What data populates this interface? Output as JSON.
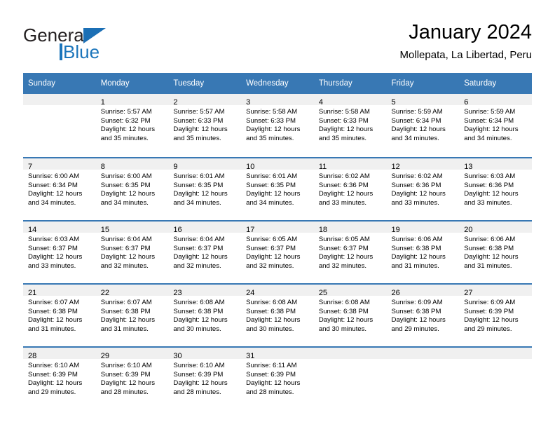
{
  "brand": {
    "name_part1": "General",
    "name_part2": "Blue",
    "logo_icon": "triangle-logo-icon"
  },
  "header": {
    "title": "January 2024",
    "subtitle": "Mollepata, La Libertad, Peru"
  },
  "calendar": {
    "weekday_headers": [
      "Sunday",
      "Monday",
      "Tuesday",
      "Wednesday",
      "Thursday",
      "Friday",
      "Saturday"
    ],
    "accent_color": "#3878b4",
    "daynum_band_color": "#f0f0f0",
    "weeks": [
      [
        {
          "day": "",
          "sunrise": "",
          "sunset": "",
          "daylight_line1": "",
          "daylight_line2": ""
        },
        {
          "day": "1",
          "sunrise": "Sunrise: 5:57 AM",
          "sunset": "Sunset: 6:32 PM",
          "daylight_line1": "Daylight: 12 hours",
          "daylight_line2": "and 35 minutes."
        },
        {
          "day": "2",
          "sunrise": "Sunrise: 5:57 AM",
          "sunset": "Sunset: 6:33 PM",
          "daylight_line1": "Daylight: 12 hours",
          "daylight_line2": "and 35 minutes."
        },
        {
          "day": "3",
          "sunrise": "Sunrise: 5:58 AM",
          "sunset": "Sunset: 6:33 PM",
          "daylight_line1": "Daylight: 12 hours",
          "daylight_line2": "and 35 minutes."
        },
        {
          "day": "4",
          "sunrise": "Sunrise: 5:58 AM",
          "sunset": "Sunset: 6:33 PM",
          "daylight_line1": "Daylight: 12 hours",
          "daylight_line2": "and 35 minutes."
        },
        {
          "day": "5",
          "sunrise": "Sunrise: 5:59 AM",
          "sunset": "Sunset: 6:34 PM",
          "daylight_line1": "Daylight: 12 hours",
          "daylight_line2": "and 34 minutes."
        },
        {
          "day": "6",
          "sunrise": "Sunrise: 5:59 AM",
          "sunset": "Sunset: 6:34 PM",
          "daylight_line1": "Daylight: 12 hours",
          "daylight_line2": "and 34 minutes."
        }
      ],
      [
        {
          "day": "7",
          "sunrise": "Sunrise: 6:00 AM",
          "sunset": "Sunset: 6:34 PM",
          "daylight_line1": "Daylight: 12 hours",
          "daylight_line2": "and 34 minutes."
        },
        {
          "day": "8",
          "sunrise": "Sunrise: 6:00 AM",
          "sunset": "Sunset: 6:35 PM",
          "daylight_line1": "Daylight: 12 hours",
          "daylight_line2": "and 34 minutes."
        },
        {
          "day": "9",
          "sunrise": "Sunrise: 6:01 AM",
          "sunset": "Sunset: 6:35 PM",
          "daylight_line1": "Daylight: 12 hours",
          "daylight_line2": "and 34 minutes."
        },
        {
          "day": "10",
          "sunrise": "Sunrise: 6:01 AM",
          "sunset": "Sunset: 6:35 PM",
          "daylight_line1": "Daylight: 12 hours",
          "daylight_line2": "and 34 minutes."
        },
        {
          "day": "11",
          "sunrise": "Sunrise: 6:02 AM",
          "sunset": "Sunset: 6:36 PM",
          "daylight_line1": "Daylight: 12 hours",
          "daylight_line2": "and 33 minutes."
        },
        {
          "day": "12",
          "sunrise": "Sunrise: 6:02 AM",
          "sunset": "Sunset: 6:36 PM",
          "daylight_line1": "Daylight: 12 hours",
          "daylight_line2": "and 33 minutes."
        },
        {
          "day": "13",
          "sunrise": "Sunrise: 6:03 AM",
          "sunset": "Sunset: 6:36 PM",
          "daylight_line1": "Daylight: 12 hours",
          "daylight_line2": "and 33 minutes."
        }
      ],
      [
        {
          "day": "14",
          "sunrise": "Sunrise: 6:03 AM",
          "sunset": "Sunset: 6:37 PM",
          "daylight_line1": "Daylight: 12 hours",
          "daylight_line2": "and 33 minutes."
        },
        {
          "day": "15",
          "sunrise": "Sunrise: 6:04 AM",
          "sunset": "Sunset: 6:37 PM",
          "daylight_line1": "Daylight: 12 hours",
          "daylight_line2": "and 32 minutes."
        },
        {
          "day": "16",
          "sunrise": "Sunrise: 6:04 AM",
          "sunset": "Sunset: 6:37 PM",
          "daylight_line1": "Daylight: 12 hours",
          "daylight_line2": "and 32 minutes."
        },
        {
          "day": "17",
          "sunrise": "Sunrise: 6:05 AM",
          "sunset": "Sunset: 6:37 PM",
          "daylight_line1": "Daylight: 12 hours",
          "daylight_line2": "and 32 minutes."
        },
        {
          "day": "18",
          "sunrise": "Sunrise: 6:05 AM",
          "sunset": "Sunset: 6:37 PM",
          "daylight_line1": "Daylight: 12 hours",
          "daylight_line2": "and 32 minutes."
        },
        {
          "day": "19",
          "sunrise": "Sunrise: 6:06 AM",
          "sunset": "Sunset: 6:38 PM",
          "daylight_line1": "Daylight: 12 hours",
          "daylight_line2": "and 31 minutes."
        },
        {
          "day": "20",
          "sunrise": "Sunrise: 6:06 AM",
          "sunset": "Sunset: 6:38 PM",
          "daylight_line1": "Daylight: 12 hours",
          "daylight_line2": "and 31 minutes."
        }
      ],
      [
        {
          "day": "21",
          "sunrise": "Sunrise: 6:07 AM",
          "sunset": "Sunset: 6:38 PM",
          "daylight_line1": "Daylight: 12 hours",
          "daylight_line2": "and 31 minutes."
        },
        {
          "day": "22",
          "sunrise": "Sunrise: 6:07 AM",
          "sunset": "Sunset: 6:38 PM",
          "daylight_line1": "Daylight: 12 hours",
          "daylight_line2": "and 31 minutes."
        },
        {
          "day": "23",
          "sunrise": "Sunrise: 6:08 AM",
          "sunset": "Sunset: 6:38 PM",
          "daylight_line1": "Daylight: 12 hours",
          "daylight_line2": "and 30 minutes."
        },
        {
          "day": "24",
          "sunrise": "Sunrise: 6:08 AM",
          "sunset": "Sunset: 6:38 PM",
          "daylight_line1": "Daylight: 12 hours",
          "daylight_line2": "and 30 minutes."
        },
        {
          "day": "25",
          "sunrise": "Sunrise: 6:08 AM",
          "sunset": "Sunset: 6:38 PM",
          "daylight_line1": "Daylight: 12 hours",
          "daylight_line2": "and 30 minutes."
        },
        {
          "day": "26",
          "sunrise": "Sunrise: 6:09 AM",
          "sunset": "Sunset: 6:38 PM",
          "daylight_line1": "Daylight: 12 hours",
          "daylight_line2": "and 29 minutes."
        },
        {
          "day": "27",
          "sunrise": "Sunrise: 6:09 AM",
          "sunset": "Sunset: 6:39 PM",
          "daylight_line1": "Daylight: 12 hours",
          "daylight_line2": "and 29 minutes."
        }
      ],
      [
        {
          "day": "28",
          "sunrise": "Sunrise: 6:10 AM",
          "sunset": "Sunset: 6:39 PM",
          "daylight_line1": "Daylight: 12 hours",
          "daylight_line2": "and 29 minutes."
        },
        {
          "day": "29",
          "sunrise": "Sunrise: 6:10 AM",
          "sunset": "Sunset: 6:39 PM",
          "daylight_line1": "Daylight: 12 hours",
          "daylight_line2": "and 28 minutes."
        },
        {
          "day": "30",
          "sunrise": "Sunrise: 6:10 AM",
          "sunset": "Sunset: 6:39 PM",
          "daylight_line1": "Daylight: 12 hours",
          "daylight_line2": "and 28 minutes."
        },
        {
          "day": "31",
          "sunrise": "Sunrise: 6:11 AM",
          "sunset": "Sunset: 6:39 PM",
          "daylight_line1": "Daylight: 12 hours",
          "daylight_line2": "and 28 minutes."
        },
        {
          "day": "",
          "sunrise": "",
          "sunset": "",
          "daylight_line1": "",
          "daylight_line2": ""
        },
        {
          "day": "",
          "sunrise": "",
          "sunset": "",
          "daylight_line1": "",
          "daylight_line2": ""
        },
        {
          "day": "",
          "sunrise": "",
          "sunset": "",
          "daylight_line1": "",
          "daylight_line2": ""
        }
      ]
    ]
  }
}
